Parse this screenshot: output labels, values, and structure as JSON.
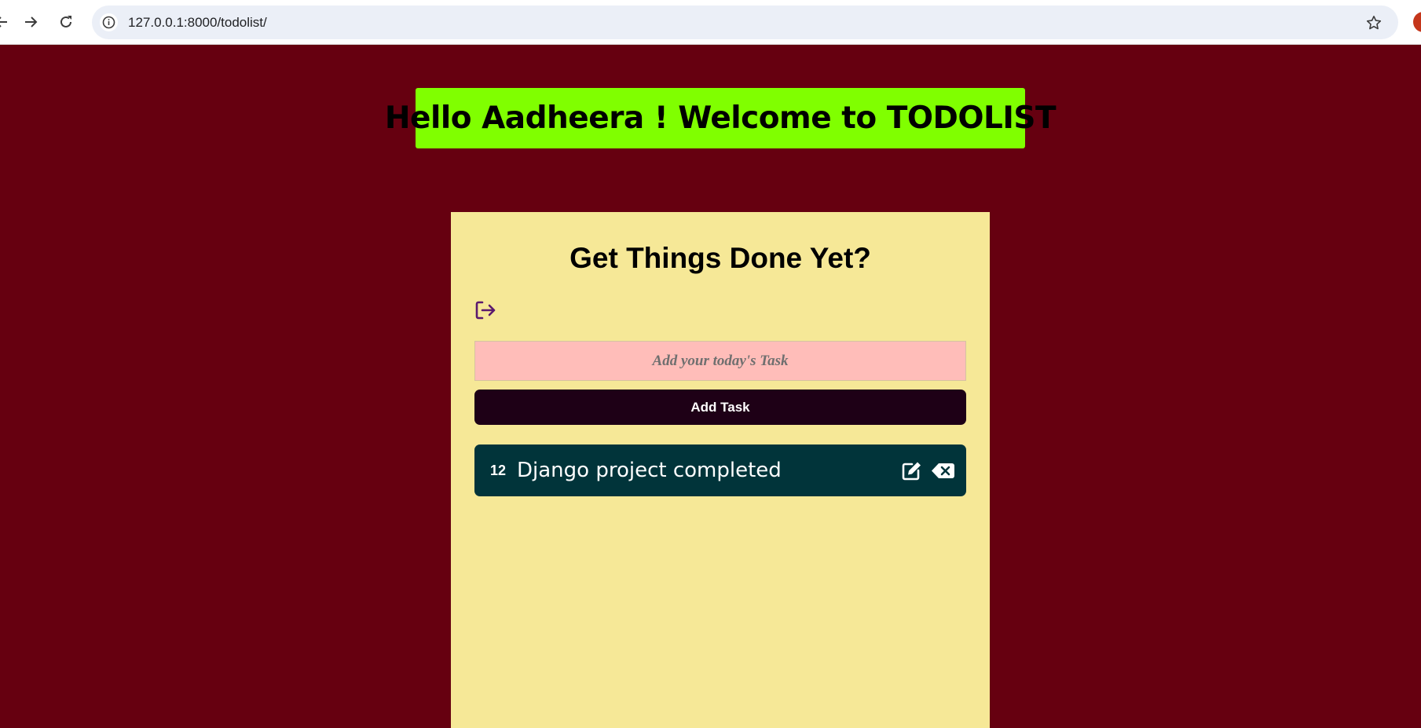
{
  "browser": {
    "url": "127.0.0.1:8000/todolist/",
    "back_icon": "arrow-left-icon",
    "forward_icon": "arrow-right-icon",
    "reload_icon": "reload-icon",
    "info_icon": "info-icon",
    "bookmark_icon": "star-icon"
  },
  "greeting": {
    "text": "Hello Aadheera ! Welcome to TODOLIST",
    "background": "#80ff00"
  },
  "card": {
    "title": "Get Things Done Yet?",
    "logout_icon": "sign-out-icon",
    "input_placeholder": "Add your today's Task",
    "input_value": "",
    "add_button_label": "Add Task",
    "background": "#f6e897"
  },
  "tasks": [
    {
      "id": "12",
      "text": "Django project completed",
      "edit_icon": "edit-icon",
      "delete_icon": "backspace-delete-icon"
    }
  ],
  "colors": {
    "page_background": "#660010",
    "input_background": "#ffbdb9",
    "button_background": "#1e0016",
    "task_background": "#01343a",
    "logout_icon_color": "#5b1a6e"
  }
}
